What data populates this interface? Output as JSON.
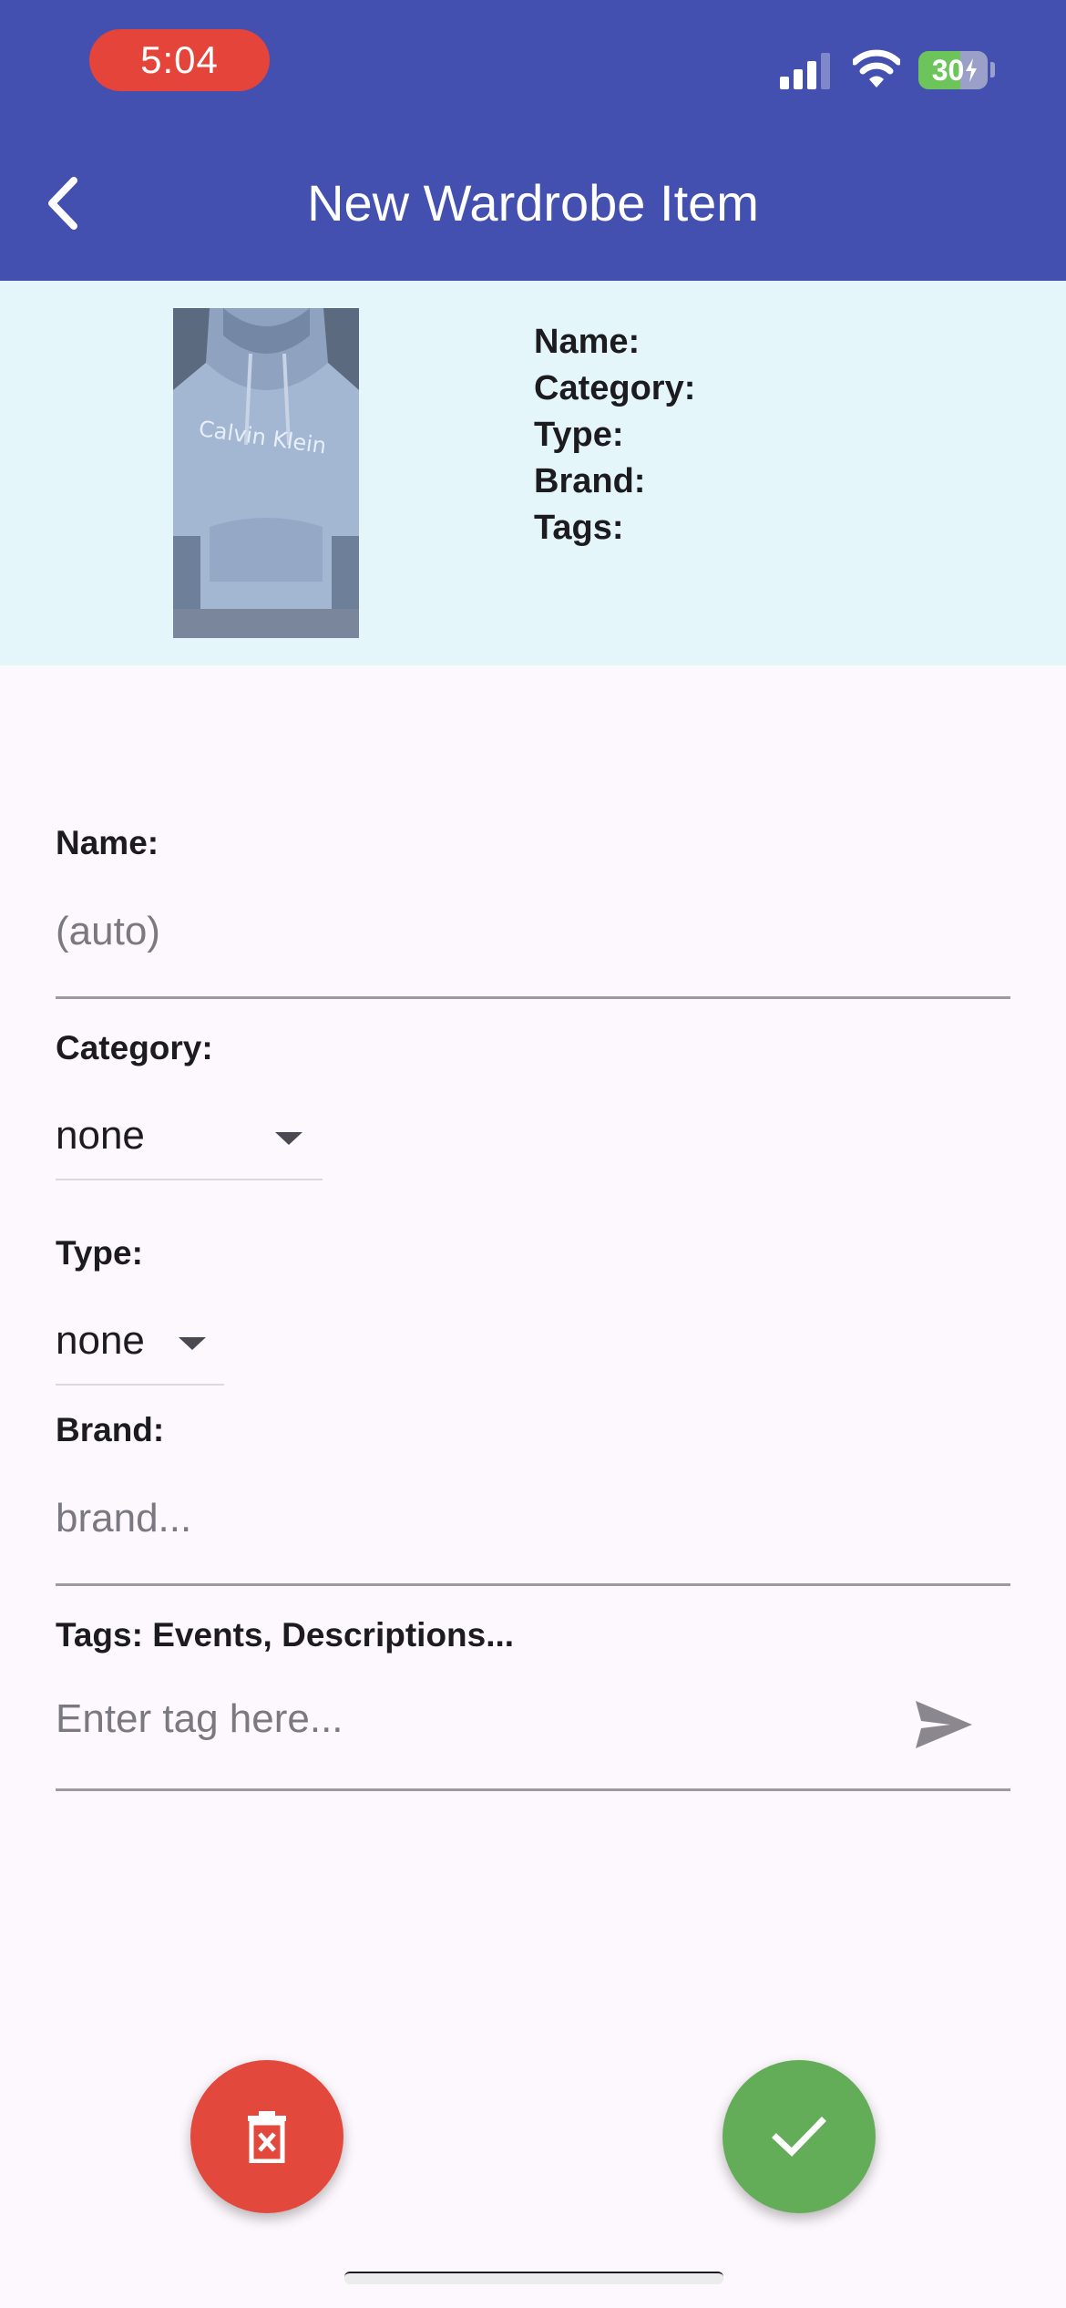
{
  "status_bar": {
    "time": "5:04",
    "battery": "30",
    "icons": [
      "cellular-signal-icon",
      "wifi-icon",
      "battery-charging-icon"
    ]
  },
  "app_bar": {
    "title": "New Wardrobe Item",
    "back_icon": "chevron-left-icon",
    "color": "#4450b0"
  },
  "preview": {
    "photo_alt": "photo of light blue hoodie",
    "summary": [
      "Name:",
      "Category:",
      "Type:",
      "Brand:",
      "Tags:"
    ],
    "background": "#e5f6fb"
  },
  "form": {
    "name": {
      "label": "Name:",
      "placeholder": "(auto)",
      "value": ""
    },
    "category": {
      "label": "Category:",
      "value": "none"
    },
    "type": {
      "label": "Type:",
      "value": "none"
    },
    "brand": {
      "label": "Brand:",
      "placeholder": "brand...",
      "value": ""
    },
    "tags": {
      "label": "Tags: Events, Descriptions...",
      "placeholder": "Enter tag here...",
      "send_icon": "send-icon"
    }
  },
  "actions": {
    "delete_icon": "trash-icon",
    "delete_color": "#e3483d",
    "save_icon": "checkmark-icon",
    "save_color": "#64ad58"
  }
}
